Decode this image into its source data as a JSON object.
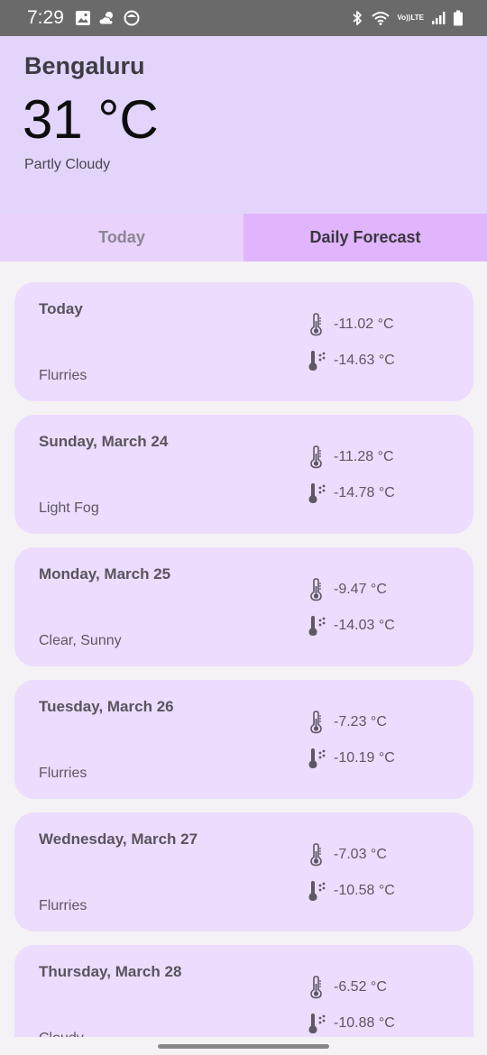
{
  "status_bar": {
    "time": "7:29",
    "left_icons": [
      "gallery-icon",
      "weather-icon",
      "app-icon"
    ],
    "right_icons": [
      "bluetooth-icon",
      "wifi-icon",
      "volte-icon",
      "signal-icon",
      "battery-icon"
    ],
    "volte_top": "Vo))",
    "volte_bottom": "LTE"
  },
  "header": {
    "city": "Bengaluru",
    "temperature": "31 °C",
    "condition": "Partly Cloudy",
    "background": "#e3d4fb"
  },
  "tabs": [
    {
      "label": "Today",
      "selected": false
    },
    {
      "label": "Daily Forecast",
      "selected": true
    }
  ],
  "forecast": [
    {
      "date": "Today",
      "condition": "Flurries",
      "max": "-11.02 °C",
      "min": "-14.63 °C"
    },
    {
      "date": "Sunday, March 24",
      "condition": "Light Fog",
      "max": "-11.28 °C",
      "min": "-14.78 °C"
    },
    {
      "date": "Monday, March 25",
      "condition": "Clear, Sunny",
      "max": "-9.47 °C",
      "min": "-14.03 °C"
    },
    {
      "date": "Tuesday, March 26",
      "condition": "Flurries",
      "max": "-7.23 °C",
      "min": "-10.19 °C"
    },
    {
      "date": "Wednesday, March 27",
      "condition": "Flurries",
      "max": "-7.03 °C",
      "min": "-10.58 °C"
    },
    {
      "date": "Thursday, March 28",
      "condition": "Cloudy",
      "max": "-6.52 °C",
      "min": "-10.88 °C"
    }
  ],
  "icons": {
    "max_temp": "thermometer-icon",
    "min_temp": "thermometer-snow-icon"
  },
  "colors": {
    "card": "#ecdcfd",
    "tab_selected": "#e0b5fb",
    "tab_unselected": "#e9d3fb"
  }
}
